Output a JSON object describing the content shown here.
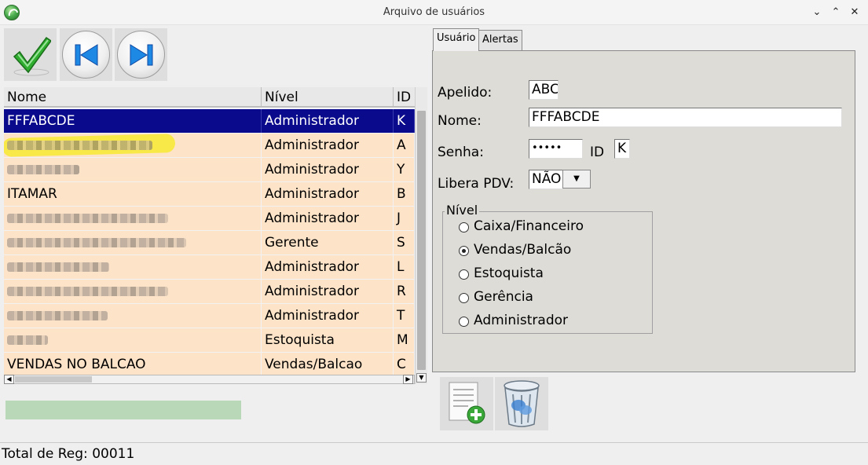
{
  "window": {
    "title": "Arquivo de usuários",
    "minimize": "⌄",
    "maximize": "⌃",
    "close": "✕"
  },
  "grid": {
    "columns": [
      "Nome",
      "Nível",
      "ID"
    ],
    "rows": [
      {
        "nome": "FFFABCDE",
        "nivel": "Administrador",
        "id": "K",
        "selected": true
      },
      {
        "nome": "",
        "nivel": "Administrador",
        "id": "A"
      },
      {
        "nome": "",
        "nivel": "Administrador",
        "id": "Y"
      },
      {
        "nome": "ITAMAR",
        "nivel": "Administrador",
        "id": "B"
      },
      {
        "nome": "",
        "nivel": "Administrador",
        "id": "J"
      },
      {
        "nome": "",
        "nivel": "Gerente",
        "id": "S"
      },
      {
        "nome": "",
        "nivel": "Administrador",
        "id": "L"
      },
      {
        "nome": "",
        "nivel": "Administrador",
        "id": "R"
      },
      {
        "nome": "",
        "nivel": "Administrador",
        "id": "T"
      },
      {
        "nome": "",
        "nivel": "Estoquista",
        "id": "M"
      },
      {
        "nome": "VENDAS NO BALCAO",
        "nivel": "Vendas/Balcao",
        "id": "C"
      }
    ]
  },
  "tabs": [
    "Usuário",
    "Alertas"
  ],
  "form": {
    "apelido_label": "Apelido:",
    "apelido_value": "ABC",
    "nome_label": "Nome:",
    "nome_value": "FFFABCDE",
    "senha_label": "Senha:",
    "senha_value": "•••••",
    "id_label": "ID",
    "id_value": "K",
    "libera_label": "Libera PDV:",
    "libera_value": "NÃO",
    "nivel_title": "Nível",
    "nivel_options": [
      "Caixa/Financeiro",
      "Vendas/Balcão",
      "Estoquista",
      "Gerência",
      "Administrador"
    ],
    "nivel_selected": "Vendas/Balcão"
  },
  "status": {
    "total": "Total de Reg: 00011"
  },
  "icons": {
    "app": "app-logo-icon",
    "confirm": "checkmark-icon",
    "first": "skip-first-icon",
    "next": "skip-next-icon",
    "new": "new-document-icon",
    "delete": "trash-icon"
  },
  "colors": {
    "selected_row": "#0a0a8c",
    "row_bg": "#fde3c7",
    "progress": "#b8d8b8",
    "panel": "#dddcd7"
  }
}
